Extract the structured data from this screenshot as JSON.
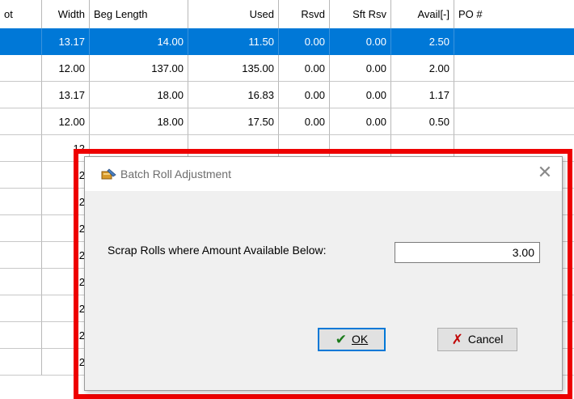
{
  "columns": [
    "ot",
    "Width",
    "Beg Length",
    "Used",
    "Rsvd",
    "Sft Rsv",
    "Avail[-]",
    "PO #"
  ],
  "rows": [
    [
      "",
      "13.17",
      "14.00",
      "11.50",
      "0.00",
      "0.00",
      "2.50",
      ""
    ],
    [
      "",
      "12.00",
      "137.00",
      "135.00",
      "0.00",
      "0.00",
      "2.00",
      ""
    ],
    [
      "",
      "13.17",
      "18.00",
      "16.83",
      "0.00",
      "0.00",
      "1.17",
      ""
    ],
    [
      "",
      "12.00",
      "18.00",
      "17.50",
      "0.00",
      "0.00",
      "0.50",
      ""
    ],
    [
      "",
      "12",
      "",
      "",
      "",
      "",
      "",
      ""
    ],
    [
      "",
      "12",
      "",
      "",
      "",
      "",
      "",
      ""
    ],
    [
      "",
      "12",
      "",
      "",
      "",
      "",
      "",
      ""
    ],
    [
      "",
      "12",
      "",
      "",
      "",
      "",
      "",
      ""
    ],
    [
      "",
      "12",
      "",
      "",
      "",
      "",
      "",
      ""
    ],
    [
      "",
      "12",
      "",
      "",
      "",
      "",
      "",
      ""
    ],
    [
      "",
      "12",
      "",
      "",
      "",
      "",
      "",
      ""
    ],
    [
      "",
      "12",
      "",
      "",
      "",
      "",
      "",
      ""
    ],
    [
      "",
      "12",
      "",
      "",
      "",
      "",
      "",
      ""
    ]
  ],
  "selected_row": 0,
  "dialog": {
    "title": "Batch Roll Adjustment",
    "close_glyph": "✕",
    "scrap_label": "Scrap Rolls where Amount Available Below:",
    "amount_value": "3.00",
    "ok_glyph": "✔",
    "ok_label": "OK",
    "cancel_glyph": "✗",
    "cancel_label": "Cancel"
  },
  "colors": {
    "selection": "#0078d7",
    "highlight_frame": "#ee0000"
  }
}
